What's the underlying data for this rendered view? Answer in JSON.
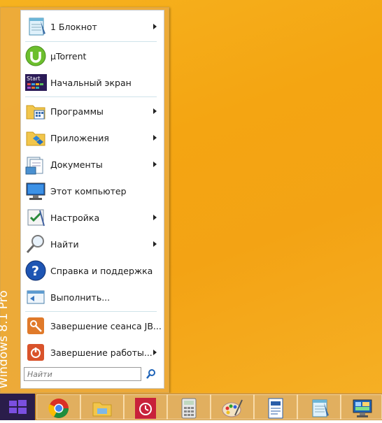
{
  "start_menu": {
    "side_label": "Windows 8.1 Pro",
    "items": [
      {
        "label": "1 Блокнот",
        "icon": "notepad-icon",
        "submenu": true
      },
      {
        "label": "µTorrent",
        "icon": "utorrent-icon",
        "submenu": false
      },
      {
        "label": "Начальный экран",
        "icon": "start-screen-icon",
        "submenu": false,
        "icon_text": "Start"
      },
      {
        "label": "Программы",
        "icon": "programs-folder-icon",
        "submenu": true
      },
      {
        "label": "Приложения",
        "icon": "apps-folder-icon",
        "submenu": true
      },
      {
        "label": "Документы",
        "icon": "documents-icon",
        "submenu": true
      },
      {
        "label": "Этот компьютер",
        "icon": "computer-icon",
        "submenu": false
      },
      {
        "label": "Настройка",
        "icon": "settings-icon",
        "submenu": true
      },
      {
        "label": "Найти",
        "icon": "search-magnifier-icon",
        "submenu": true
      },
      {
        "label": "Справка и поддержка",
        "icon": "help-icon",
        "submenu": false
      },
      {
        "label": "Выполнить...",
        "icon": "run-icon",
        "submenu": false
      },
      {
        "label": "Завершение сеанса JB...",
        "icon": "logoff-key-icon",
        "submenu": false
      },
      {
        "label": "Завершение работы...",
        "icon": "shutdown-icon",
        "submenu": true
      }
    ],
    "search": {
      "placeholder": "Найти"
    }
  },
  "taskbar": {
    "pinned": [
      "chrome-icon",
      "file-explorer-icon",
      "alarm-clock-icon",
      "calculator-icon",
      "paint-icon",
      "wordpad-icon",
      "notepad-icon",
      "control-panel-icon"
    ]
  },
  "colors": {
    "desktop": "#f4a512",
    "start_button": "#2a1d4a",
    "accent_windows": "#7b4fe0"
  }
}
